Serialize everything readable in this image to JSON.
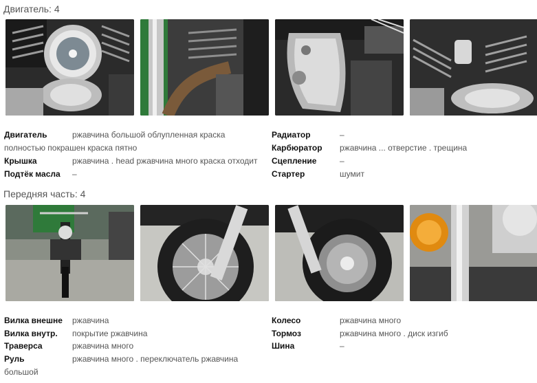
{
  "engine": {
    "title": "Двигатель: 4",
    "photos": [
      {
        "icon": "engine-chrome-air-cleaner-photo"
      },
      {
        "icon": "engine-exhaust-pipe-photo"
      },
      {
        "icon": "engine-chrome-cover-photo"
      },
      {
        "icon": "engine-cylinder-fins-photo"
      }
    ],
    "left": [
      {
        "label": "Двигатель",
        "value": "ржавчина большой облупленная краска",
        "cont": "полностью покрашен краска пятно"
      },
      {
        "label": "Крышка",
        "value": "ржавчина . head ржавчина много краска отходит"
      },
      {
        "label": "Подтёк масла",
        "value": "–"
      }
    ],
    "right": [
      {
        "label": "Радиатор",
        "value": "–"
      },
      {
        "label": "Карбюратор",
        "value": "ржавчина ... отверстие . трещина"
      },
      {
        "label": "Сцепление",
        "value": "–"
      },
      {
        "label": "Стартер",
        "value": "шумит"
      }
    ]
  },
  "front": {
    "title": "Передняя часть: 4",
    "photos": [
      {
        "icon": "motorcycle-front-view-photo"
      },
      {
        "icon": "front-wheel-tire-photo"
      },
      {
        "icon": "front-brake-disc-photo"
      },
      {
        "icon": "turn-signal-fork-photo"
      }
    ],
    "left": [
      {
        "label": "Вилка внешне",
        "value": "ржавчина"
      },
      {
        "label": "Вилка внутр.",
        "value": "покрытие ржавчина"
      },
      {
        "label": "Траверса",
        "value": "ржавчина много"
      },
      {
        "label": "Руль",
        "value": "ржавчина много . переключатель ржавчина",
        "cont": "большой"
      }
    ],
    "right": [
      {
        "label": "Колесо",
        "value": "ржавчина много"
      },
      {
        "label": "Тормоз",
        "value": "ржавчина много . диск изгиб"
      },
      {
        "label": "Шина",
        "value": "–"
      }
    ]
  }
}
